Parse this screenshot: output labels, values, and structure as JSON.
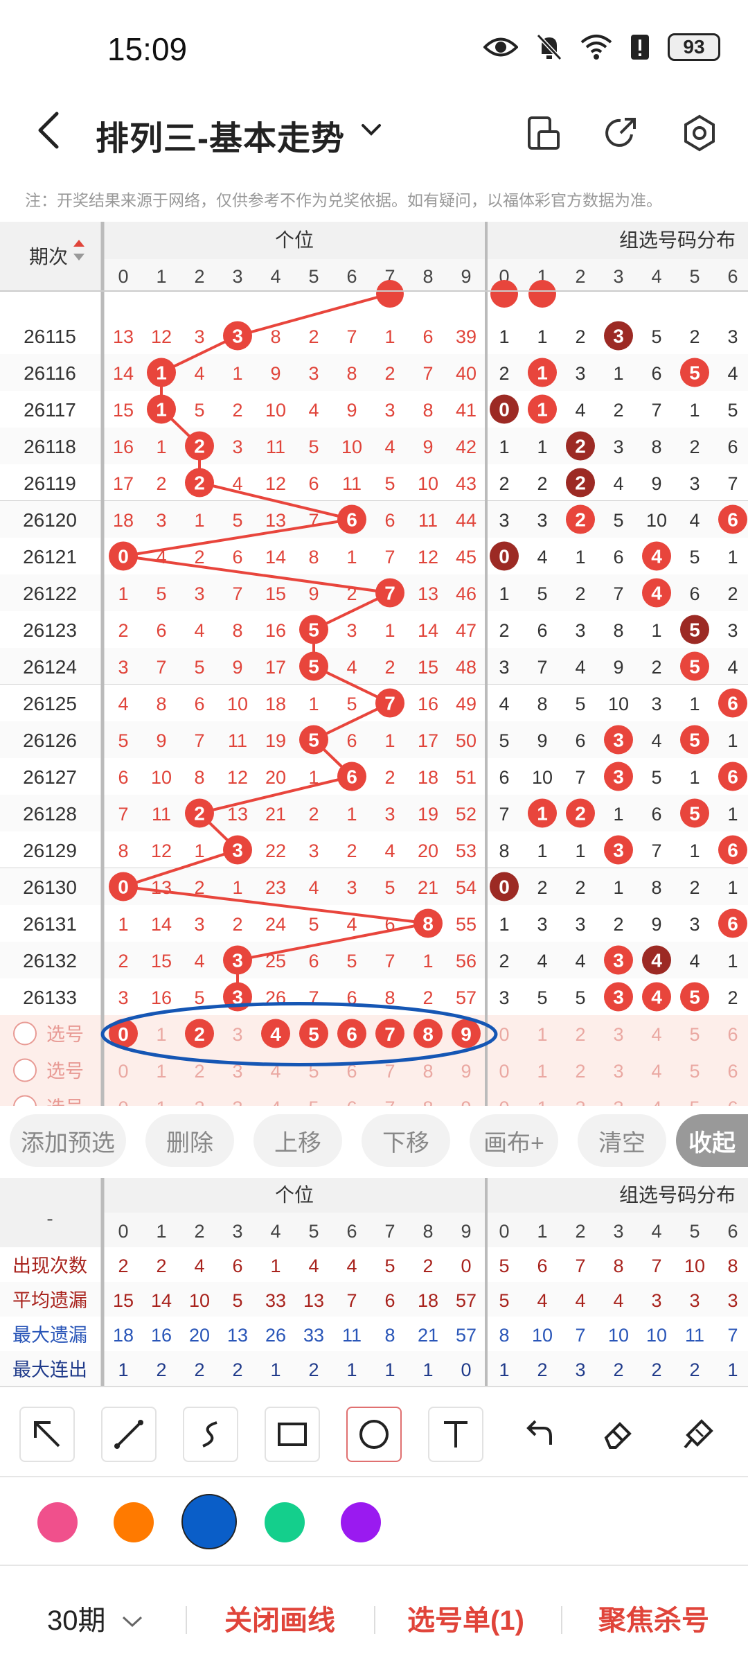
{
  "status": {
    "time": "15:09",
    "battery": "93"
  },
  "header": {
    "title": "排列三-基本走势"
  },
  "note": "注：开奖结果来源于网络，仅供参考不作为兑奖依据。如有疑问，以福体彩官方数据为准。",
  "table": {
    "period_header": "期次",
    "unit_header": "个位",
    "group_header": "组选号码分布",
    "digits": [
      "0",
      "1",
      "2",
      "3",
      "4",
      "5",
      "6",
      "7",
      "8",
      "9"
    ],
    "group_digits": [
      "0",
      "1",
      "2",
      "3",
      "4",
      "5",
      "6"
    ],
    "rows": [
      {
        "period": "26115",
        "win": 3,
        "cells": [
          13,
          12,
          3,
          3,
          8,
          2,
          7,
          1,
          6,
          39
        ],
        "group": [
          1,
          1,
          2,
          3,
          5,
          2,
          3
        ],
        "group_hits": [
          3
        ]
      },
      {
        "period": "26116",
        "win": 1,
        "cells": [
          14,
          1,
          4,
          1,
          9,
          3,
          8,
          2,
          7,
          40
        ],
        "group": [
          2,
          1,
          3,
          1,
          6,
          5,
          4
        ],
        "group_hits": [
          1,
          5
        ]
      },
      {
        "period": "26117",
        "win": 1,
        "cells": [
          15,
          1,
          5,
          2,
          10,
          4,
          9,
          3,
          8,
          41
        ],
        "group": [
          0,
          1,
          4,
          2,
          7,
          1,
          5
        ],
        "group_hits": [
          0,
          1
        ]
      },
      {
        "period": "26118",
        "win": 2,
        "cells": [
          16,
          1,
          2,
          3,
          11,
          5,
          10,
          4,
          9,
          42
        ],
        "group": [
          1,
          1,
          2,
          3,
          8,
          2,
          6
        ],
        "group_hits": [
          2
        ]
      },
      {
        "period": "26119",
        "win": 2,
        "cells": [
          17,
          2,
          2,
          4,
          12,
          6,
          11,
          5,
          10,
          43
        ],
        "group": [
          2,
          2,
          2,
          4,
          9,
          3,
          7
        ],
        "group_hits": [
          2
        ]
      },
      {
        "period": "26120",
        "win": 6,
        "cells": [
          18,
          3,
          1,
          5,
          13,
          7,
          6,
          6,
          11,
          44
        ],
        "group": [
          3,
          3,
          2,
          5,
          10,
          4,
          6
        ],
        "group_hits": [
          2,
          6
        ]
      },
      {
        "period": "26121",
        "win": 0,
        "cells": [
          0,
          4,
          2,
          6,
          14,
          8,
          1,
          7,
          12,
          45
        ],
        "group": [
          0,
          4,
          1,
          6,
          4,
          5,
          1
        ],
        "group_hits": [
          0,
          4
        ]
      },
      {
        "period": "26122",
        "win": 7,
        "cells": [
          1,
          5,
          3,
          7,
          15,
          9,
          2,
          7,
          13,
          46
        ],
        "group": [
          1,
          5,
          2,
          7,
          4,
          6,
          2
        ],
        "group_hits": [
          4
        ]
      },
      {
        "period": "26123",
        "win": 5,
        "cells": [
          2,
          6,
          4,
          8,
          16,
          5,
          3,
          1,
          14,
          47
        ],
        "group": [
          2,
          6,
          3,
          8,
          1,
          5,
          3
        ],
        "group_hits": [
          5
        ]
      },
      {
        "period": "26124",
        "win": 5,
        "cells": [
          3,
          7,
          5,
          9,
          17,
          5,
          4,
          2,
          15,
          48
        ],
        "group": [
          3,
          7,
          4,
          9,
          2,
          5,
          4
        ],
        "group_hits": [
          5
        ]
      },
      {
        "period": "26125",
        "win": 7,
        "cells": [
          4,
          8,
          6,
          10,
          18,
          1,
          5,
          7,
          16,
          49
        ],
        "group": [
          4,
          8,
          5,
          10,
          3,
          1,
          6
        ],
        "group_hits": [
          6
        ]
      },
      {
        "period": "26126",
        "win": 5,
        "cells": [
          5,
          9,
          7,
          11,
          19,
          5,
          6,
          1,
          17,
          50
        ],
        "group": [
          5,
          9,
          6,
          3,
          4,
          5,
          1
        ],
        "group_hits": [
          3,
          5
        ]
      },
      {
        "period": "26127",
        "win": 6,
        "cells": [
          6,
          10,
          8,
          12,
          20,
          1,
          6,
          2,
          18,
          51
        ],
        "group": [
          6,
          10,
          7,
          3,
          5,
          1,
          6
        ],
        "group_hits": [
          3,
          6
        ]
      },
      {
        "period": "26128",
        "win": 2,
        "cells": [
          7,
          11,
          2,
          13,
          21,
          2,
          1,
          3,
          19,
          52
        ],
        "group": [
          7,
          1,
          2,
          1,
          6,
          5,
          1
        ],
        "group_hits": [
          1,
          2,
          5
        ]
      },
      {
        "period": "26129",
        "win": 3,
        "cells": [
          8,
          12,
          1,
          3,
          22,
          3,
          2,
          4,
          20,
          53
        ],
        "group": [
          8,
          1,
          1,
          3,
          7,
          1,
          6
        ],
        "group_hits": [
          3,
          6
        ]
      },
      {
        "period": "26130",
        "win": 0,
        "cells": [
          0,
          13,
          2,
          1,
          23,
          4,
          3,
          5,
          21,
          54
        ],
        "group": [
          0,
          2,
          2,
          1,
          8,
          2,
          1
        ],
        "group_hits": [
          0
        ]
      },
      {
        "period": "26131",
        "win": 8,
        "cells": [
          1,
          14,
          3,
          2,
          24,
          5,
          4,
          6,
          8,
          55
        ],
        "group": [
          1,
          3,
          3,
          2,
          9,
          3,
          6
        ],
        "group_hits": [
          6
        ]
      },
      {
        "period": "26132",
        "win": 3,
        "cells": [
          2,
          15,
          4,
          3,
          25,
          6,
          5,
          7,
          1,
          56
        ],
        "group": [
          2,
          4,
          4,
          3,
          4,
          4,
          1
        ],
        "group_hits": [
          3,
          4
        ]
      },
      {
        "period": "26133",
        "win": 3,
        "cells": [
          3,
          16,
          5,
          3,
          26,
          7,
          6,
          8,
          2,
          57
        ],
        "group": [
          3,
          5,
          5,
          3,
          4,
          5,
          2
        ],
        "group_hits": [
          3,
          4,
          5
        ]
      }
    ],
    "select_label": "选号",
    "selected_digits": [
      0,
      2,
      4,
      5,
      6,
      7,
      8,
      9
    ]
  },
  "actions": [
    "添加预选",
    "删除",
    "上移",
    "下移",
    "画布+",
    "清空",
    "收起"
  ],
  "stats": {
    "row_labels": [
      "出现次数",
      "平均遗漏",
      "最大遗漏",
      "最大连出"
    ],
    "corner": "-",
    "unit": [
      [
        2,
        2,
        4,
        6,
        1,
        4,
        4,
        5,
        2,
        0
      ],
      [
        15,
        14,
        10,
        5,
        33,
        13,
        7,
        6,
        18,
        57
      ],
      [
        18,
        16,
        20,
        13,
        26,
        33,
        11,
        8,
        21,
        57
      ],
      [
        1,
        2,
        2,
        2,
        1,
        2,
        1,
        1,
        1,
        0
      ]
    ],
    "group": [
      [
        5,
        6,
        7,
        8,
        7,
        10,
        8
      ],
      [
        5,
        4,
        4,
        4,
        3,
        3,
        3
      ],
      [
        8,
        10,
        7,
        10,
        10,
        11,
        7
      ],
      [
        1,
        2,
        3,
        2,
        2,
        2,
        1
      ]
    ]
  },
  "tools": [
    "arrow-tool",
    "line-tool",
    "curve-tool",
    "rect-tool",
    "circle-tool",
    "text-tool",
    "undo-tool",
    "eraser-tool",
    "brush-tool"
  ],
  "colors": [
    "#f0508c",
    "#ff7a00",
    "#0a5ec8",
    "#14cf8c",
    "#9a1af0"
  ],
  "bottom": {
    "period": "30期",
    "close_line": "关闭画线",
    "ticket": "选号单(1)",
    "focus": "聚焦杀号"
  }
}
